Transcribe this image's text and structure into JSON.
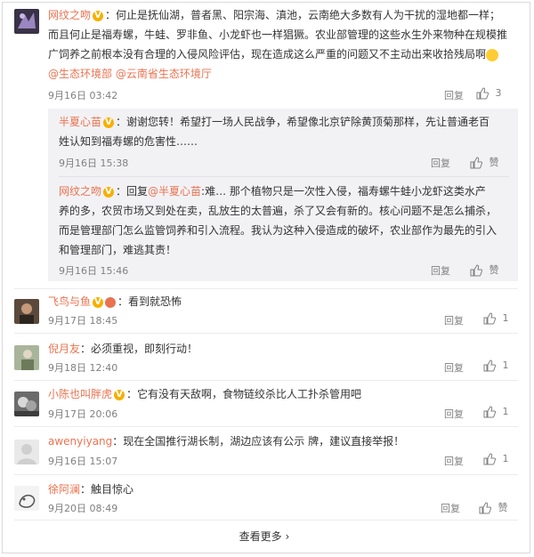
{
  "comments": [
    {
      "user": "网纹之吻",
      "text_line1": "：何止是抚仙湖，普者黑、阳宗海、滇池，云南绝大多数有人为干扰的湿地都一样；",
      "text_line2": "而且何止是福寿螺，牛蛙、罗非鱼、小龙虾也一样猖獗。农业部管理的这些水生外来物种在规模推",
      "text_line3": "广饲养之前根本没有合理的入侵风险评估，现在造成这么严重的问题又不主动出来收拾残局啊",
      "mention1": "@生态环境部",
      "mention2": "@云南省生态环境厅",
      "time": "9月16日 03:42",
      "reply": "回复",
      "likes": "3",
      "replies": [
        {
          "user": "半夏心苗",
          "text_line1": "：谢谢您转！希望打一场人民战争，希望像北京铲除黄顶菊那样，先让普通老百",
          "text_line2": "姓认知到福寿螺的危害性……",
          "time": "9月16日 15:38",
          "reply": "回复",
          "like": "赞"
        },
        {
          "user": "网纹之吻",
          "prefix": "：回复",
          "mention": "@半夏心苗",
          "text_line1": ":难… 那个植物只是一次性入侵，福寿螺牛蛙小龙虾这类水产",
          "text_line2": "养的多，农贸市场又到处在卖，乱放生的太普遍，杀了又会有新的。核心问题不是怎么捕杀，",
          "text_line3": "而是管理部门怎么监管饲养和引入流程。我认为这种入侵造成的破坏，农业部作为最先的引入",
          "text_line4": "和管理部门，难逃其责！",
          "time": "9月16日 15:46",
          "reply": "回复",
          "like": "赞"
        }
      ]
    },
    {
      "user": "飞鸟与鱼",
      "text": "：看到就恐怖",
      "time": "9月17日 18:45",
      "reply": "回复",
      "likes": "1"
    },
    {
      "user": "倪月友",
      "text": "：必须重视，即刻行动！",
      "time": "9月18日 12:40",
      "reply": "回复",
      "likes": "1"
    },
    {
      "user": "小陈也叫胖虎",
      "text": "：它有没有天敌啊，食物链绞杀比人工扑杀管用吧",
      "time": "9月17日 20:06",
      "reply": "回复",
      "likes": "1"
    },
    {
      "user": "awenyiyang",
      "text": "：现在全国推行湖长制，湖边应该有公示 牌，建议直接举报！",
      "time": "9月16日 15:07",
      "reply": "回复",
      "likes": "1"
    },
    {
      "user": "徐阿澜",
      "text": "：触目惊心",
      "time": "9月20日 08:49",
      "reply": "回复",
      "like": "赞"
    }
  ],
  "badges": {
    "v": "V"
  },
  "more_label": "查看更多",
  "more_chevron": "›",
  "colors": {
    "link": "#eb7350",
    "meta": "#808080",
    "reply_bg": "#f2f2f5"
  }
}
